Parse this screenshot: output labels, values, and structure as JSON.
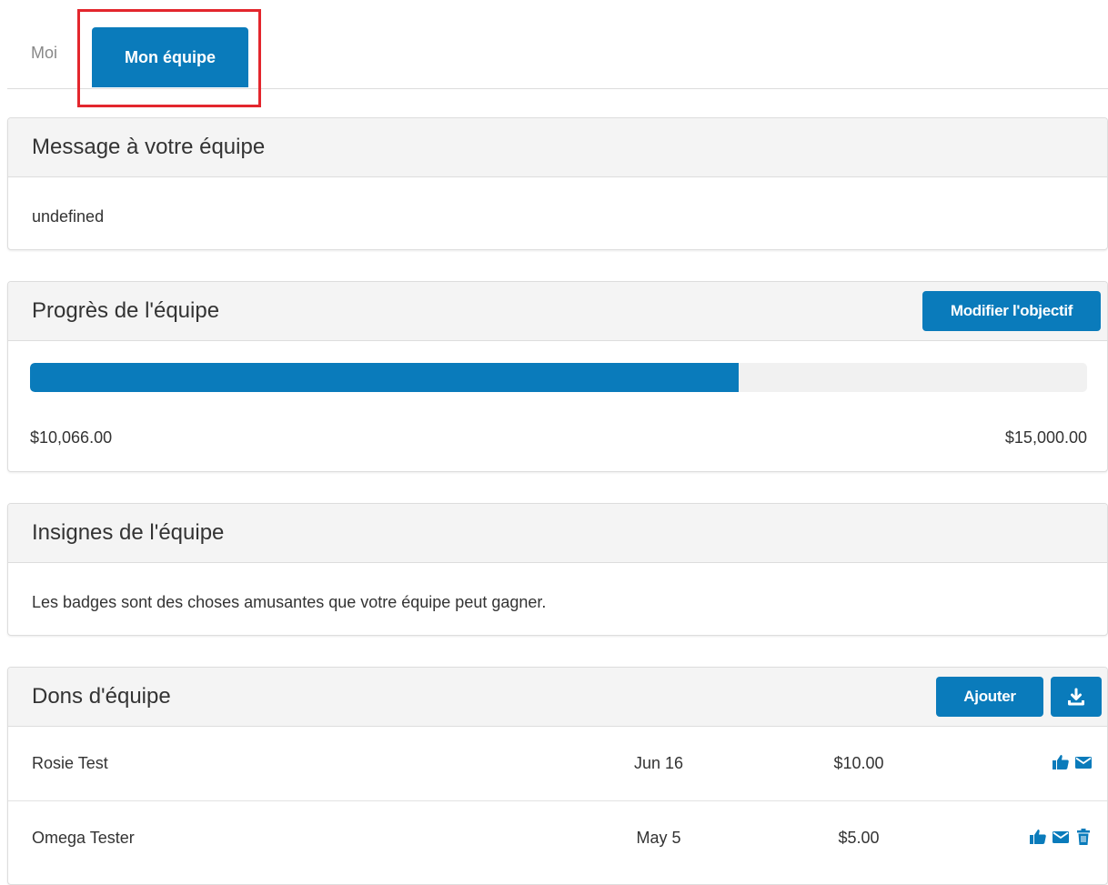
{
  "tabs": [
    {
      "label": "Moi",
      "active": false
    },
    {
      "label": "Mon équipe",
      "active": true
    }
  ],
  "colors": {
    "accent": "#0a7bbb",
    "highlight": "#e3262d"
  },
  "message_panel": {
    "title": "Message à votre équipe",
    "body": "undefined"
  },
  "progress_panel": {
    "title": "Progrès de l'équipe",
    "edit_button_label": "Modifier l'objectif",
    "raised": "$10,066.00",
    "goal": "$15,000.00",
    "progress_fraction": 0.67
  },
  "badges_panel": {
    "title": "Insignes de l'équipe",
    "body": "Les badges sont des choses amusantes que votre équipe peut gagner."
  },
  "donations_panel": {
    "title": "Dons d'équipe",
    "add_button_label": "Ajouter",
    "download_icon": "download-icon",
    "rows": [
      {
        "name": "Rosie Test",
        "date": "Jun 16",
        "amount": "$10.00",
        "icons": [
          "thumbs-up-icon",
          "envelope-icon"
        ]
      },
      {
        "name": "Omega Tester",
        "date": "May 5",
        "amount": "$5.00",
        "icons": [
          "thumbs-up-icon",
          "envelope-icon",
          "trash-icon"
        ]
      }
    ]
  }
}
